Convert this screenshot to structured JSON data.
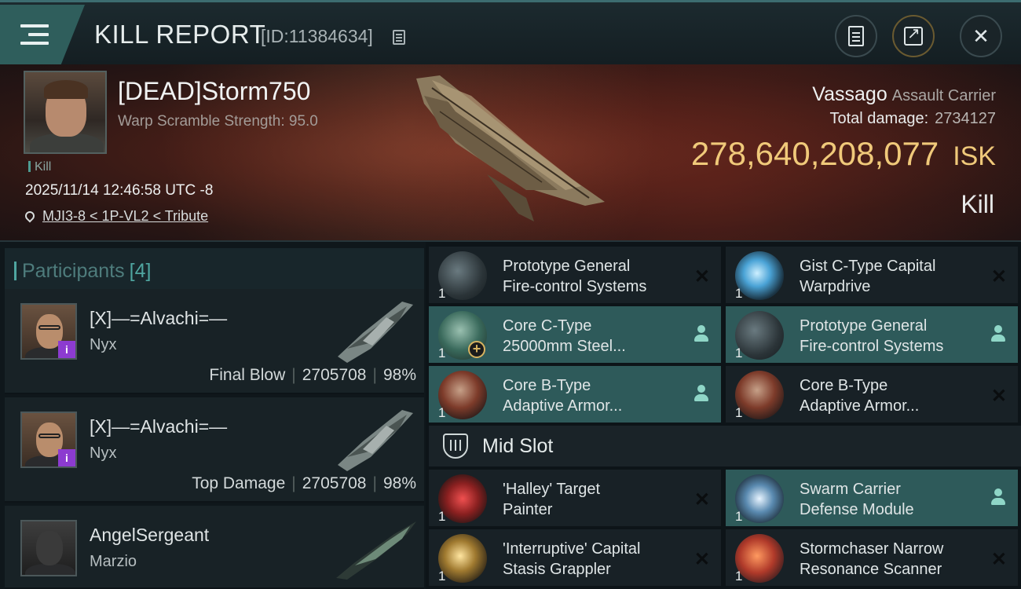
{
  "header": {
    "title": "KILL REPORT",
    "report_id": "[ID:11384634]"
  },
  "victim": {
    "name": "[DEAD]Storm750",
    "warp_scramble": "Warp Scramble Strength: 95.0",
    "tag": "Kill",
    "datetime": "2025/11/14 12:46:58 UTC -8",
    "location": "MJI3-8 < 1P-VL2 < Tribute",
    "ship_name": "Vassago",
    "ship_class": "Assault Carrier",
    "total_damage_label": "Total damage:",
    "total_damage": "2734127",
    "isk_value": "278,640,208,077",
    "isk_unit": "ISK",
    "result": "Kill"
  },
  "participants": {
    "label": "Participants",
    "count": "[4]",
    "rows": [
      {
        "name": "[X]—=Alvachi=—",
        "ship": "Nyx",
        "role": "Final Blow",
        "damage": "2705708",
        "percent": "98%",
        "badge": "i"
      },
      {
        "name": "[X]—=Alvachi=—",
        "ship": "Nyx",
        "role": "Top Damage",
        "damage": "2705708",
        "percent": "98%",
        "badge": "i"
      },
      {
        "name": "AngelSergeant",
        "ship": "Marzio"
      }
    ]
  },
  "modules": {
    "high": [
      {
        "line1": "Prototype General",
        "line2": "Fire-control Systems",
        "qty": "1",
        "icon": "fire-control-icon",
        "state": "destroyed"
      },
      {
        "line1": "Gist C-Type Capital",
        "line2": "Warpdrive",
        "qty": "1",
        "icon": "warpdrive-icon",
        "state": "destroyed"
      },
      {
        "line1": "Core C-Type",
        "line2": "25000mm Steel...",
        "qty": "1",
        "icon": "steel-plate-icon",
        "state": "dropped"
      },
      {
        "line1": "Prototype General",
        "line2": "Fire-control Systems",
        "qty": "1",
        "icon": "fire-control-icon",
        "state": "dropped"
      },
      {
        "line1": "Core B-Type",
        "line2": "Adaptive Armor...",
        "qty": "1",
        "icon": "armor-icon",
        "state": "dropped"
      },
      {
        "line1": "Core B-Type",
        "line2": "Adaptive Armor...",
        "qty": "1",
        "icon": "armor-icon",
        "state": "destroyed"
      }
    ],
    "mid_slot_label": "Mid Slot",
    "mid": [
      {
        "line1": "'Halley' Target",
        "line2": "Painter",
        "qty": "1",
        "icon": "target-painter-icon",
        "state": "destroyed"
      },
      {
        "line1": "Swarm Carrier",
        "line2": "Defense Module",
        "qty": "1",
        "icon": "defense-module-icon",
        "state": "dropped"
      },
      {
        "line1": "'Interruptive' Capital",
        "line2": "Stasis Grappler",
        "qty": "1",
        "icon": "stasis-grappler-icon",
        "state": "destroyed"
      },
      {
        "line1": "Stormchaser Narrow",
        "line2": "Resonance Scanner",
        "qty": "1",
        "icon": "scanner-icon",
        "state": "destroyed"
      }
    ]
  },
  "colors": {
    "accent": "#4fa5a0",
    "isk": "#f0c97a",
    "highlight_row": "#2e5a5a"
  }
}
